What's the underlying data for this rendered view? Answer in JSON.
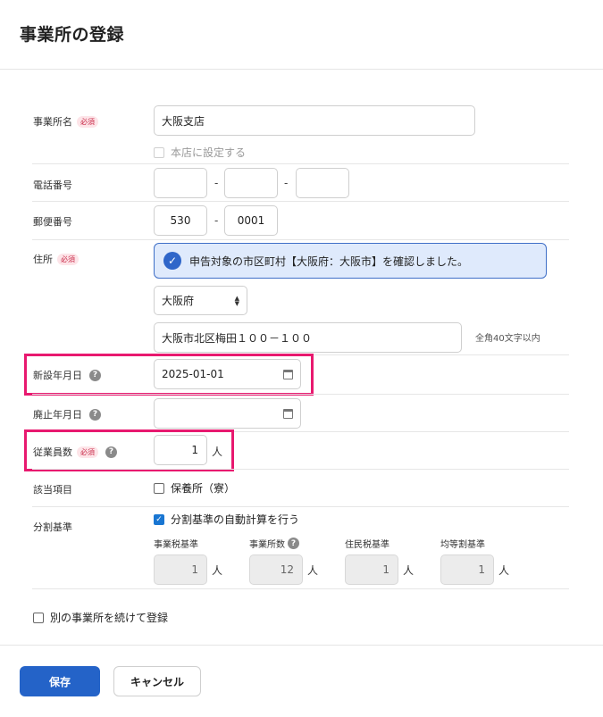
{
  "dialog": {
    "title": "事業所の登録"
  },
  "required_badge": "必須",
  "help_glyph": "?",
  "office_name": {
    "label": "事業所名",
    "value": "大阪支店"
  },
  "head_office": {
    "label": "本店に設定する",
    "checked": false,
    "disabled": true
  },
  "phone": {
    "label": "電話番号",
    "parts": [
      "",
      "",
      ""
    ],
    "separator": "-"
  },
  "postal": {
    "label": "郵便番号",
    "part1": "530",
    "part2": "0001",
    "separator": "-"
  },
  "address": {
    "label": "住所",
    "notice": "申告対象の市区町村【大阪府：大阪市】を確認しました。",
    "prefecture": "大阪府",
    "street": "大阪市北区梅田１００－１００",
    "hint": "全角40文字以内"
  },
  "established_date": {
    "label": "新設年月日",
    "value": "2025-01-01"
  },
  "closed_date": {
    "label": "廃止年月日",
    "value": ""
  },
  "employees": {
    "label": "従業員数",
    "value": "1",
    "unit": "人"
  },
  "applicable": {
    "label": "該当項目",
    "option": "保養所（寮）",
    "checked": false
  },
  "division": {
    "label": "分割基準",
    "auto_calc_label": "分割基準の自動計算を行う",
    "auto_calc_checked": true,
    "fields": [
      {
        "label": "事業税基準",
        "value": "1",
        "unit": "人"
      },
      {
        "label": "事業所数",
        "value": "12",
        "unit": "人",
        "help": true
      },
      {
        "label": "住民税基準",
        "value": "1",
        "unit": "人"
      },
      {
        "label": "均等割基準",
        "value": "1",
        "unit": "人"
      }
    ]
  },
  "continue_register": {
    "label": "別の事業所を続けて登録",
    "checked": false
  },
  "buttons": {
    "save": "保存",
    "cancel": "キャンセル"
  },
  "colors": {
    "primary": "#2463c8",
    "highlight": "#e8196f",
    "notice_bg": "#dfeafc",
    "required": "#c92c4a"
  }
}
